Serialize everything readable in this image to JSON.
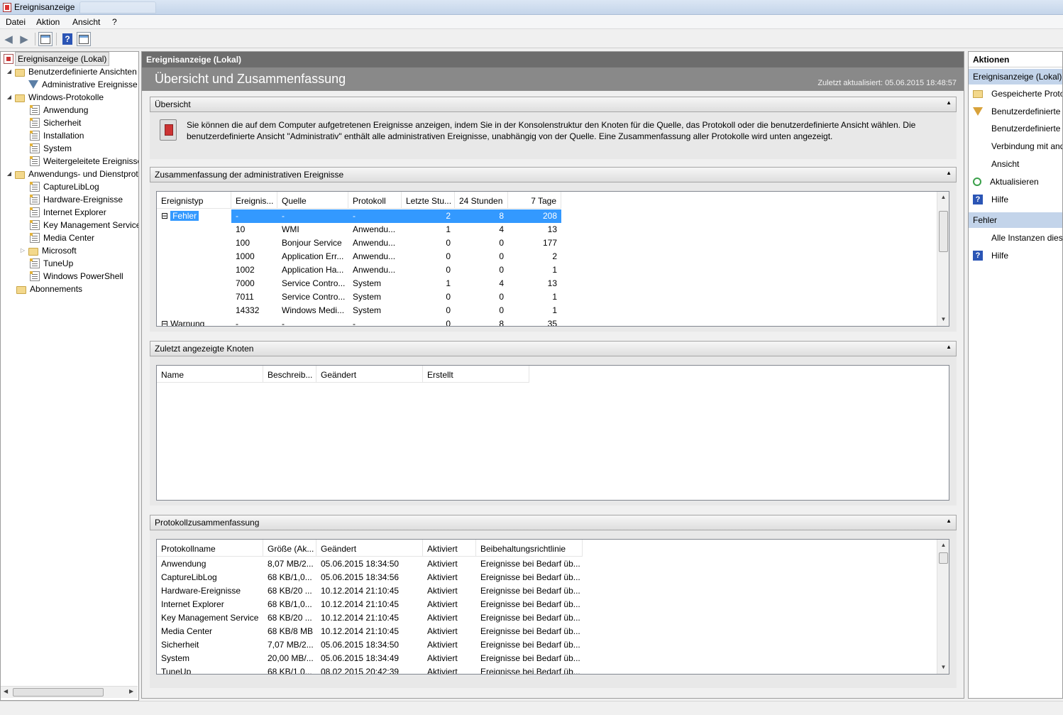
{
  "window": {
    "title": "Ereignisanzeige"
  },
  "menu": [
    "Datei",
    "Aktion",
    "Ansicht",
    "?"
  ],
  "tree": {
    "root": "Ereignisanzeige (Lokal)",
    "custom_views": "Benutzerdefinierte Ansichten",
    "admin_events": "Administrative Ereignisse",
    "windows_logs": "Windows-Protokolle",
    "windows_logs_items": [
      "Anwendung",
      "Sicherheit",
      "Installation",
      "System",
      "Weitergeleitete Ereignisse"
    ],
    "app_services": "Anwendungs- und Dienstprotokolle",
    "app_services_items": [
      "CaptureLibLog",
      "Hardware-Ereignisse",
      "Internet Explorer",
      "Key Management Service",
      "Media Center",
      "Microsoft",
      "TuneUp",
      "Windows PowerShell"
    ],
    "subscriptions": "Abonnements"
  },
  "center": {
    "header": "Ereignisanzeige (Lokal)",
    "title": "Übersicht und Zusammenfassung",
    "updated": "Zuletzt aktualisiert: 05.06.2015 18:48:57",
    "overview": {
      "header": "Übersicht",
      "text": "Sie können die auf dem Computer aufgetretenen Ereignisse anzeigen, indem Sie in der Konsolenstruktur den Knoten für die Quelle, das Protokoll oder die benutzerdefinierte Ansicht wählen. Die benutzerdefinierte Ansicht \"Administrativ\" enthält alle administrativen Ereignisse, unabhängig von der Quelle. Eine Zusammenfassung aller Protokolle wird unten angezeigt."
    },
    "admin_summary": {
      "header": "Zusammenfassung der administrativen Ereignisse",
      "columns": [
        "Ereignistyp",
        "Ereignis...",
        "Quelle",
        "Protokoll",
        "Letzte Stu...",
        "24 Stunden",
        "7 Tage"
      ],
      "rows": [
        [
          "Fehler",
          "-",
          "-",
          "-",
          "2",
          "8",
          "208"
        ],
        [
          "",
          "10",
          "WMI",
          "Anwendu...",
          "1",
          "4",
          "13"
        ],
        [
          "",
          "100",
          "Bonjour Service",
          "Anwendu...",
          "0",
          "0",
          "177"
        ],
        [
          "",
          "1000",
          "Application Err...",
          "Anwendu...",
          "0",
          "0",
          "2"
        ],
        [
          "",
          "1002",
          "Application Ha...",
          "Anwendu...",
          "0",
          "0",
          "1"
        ],
        [
          "",
          "7000",
          "Service Contro...",
          "System",
          "1",
          "4",
          "13"
        ],
        [
          "",
          "7011",
          "Service Contro...",
          "System",
          "0",
          "0",
          "1"
        ],
        [
          "",
          "14332",
          "Windows Medi...",
          "System",
          "0",
          "0",
          "1"
        ],
        [
          "Warnung",
          "-",
          "-",
          "-",
          "0",
          "8",
          "35"
        ]
      ]
    },
    "recent_nodes": {
      "header": "Zuletzt angezeigte Knoten",
      "columns": [
        "Name",
        "Beschreib...",
        "Geändert",
        "Erstellt"
      ]
    },
    "log_summary": {
      "header": "Protokollzusammenfassung",
      "columns": [
        "Protokollname",
        "Größe (Ak...",
        "Geändert",
        "Aktiviert",
        "Beibehaltungsrichtlinie"
      ],
      "rows": [
        [
          "Anwendung",
          "8,07 MB/2...",
          "05.06.2015 18:34:50",
          "Aktiviert",
          "Ereignisse bei Bedarf üb..."
        ],
        [
          "CaptureLibLog",
          "68 KB/1,0...",
          "05.06.2015 18:34:56",
          "Aktiviert",
          "Ereignisse bei Bedarf üb..."
        ],
        [
          "Hardware-Ereignisse",
          "68 KB/20 ...",
          "10.12.2014 21:10:45",
          "Aktiviert",
          "Ereignisse bei Bedarf üb..."
        ],
        [
          "Internet Explorer",
          "68 KB/1,0...",
          "10.12.2014 21:10:45",
          "Aktiviert",
          "Ereignisse bei Bedarf üb..."
        ],
        [
          "Key Management Service",
          "68 KB/20 ...",
          "10.12.2014 21:10:45",
          "Aktiviert",
          "Ereignisse bei Bedarf üb..."
        ],
        [
          "Media Center",
          "68 KB/8 MB",
          "10.12.2014 21:10:45",
          "Aktiviert",
          "Ereignisse bei Bedarf üb..."
        ],
        [
          "Sicherheit",
          "7,07 MB/2...",
          "05.06.2015 18:34:50",
          "Aktiviert",
          "Ereignisse bei Bedarf üb..."
        ],
        [
          "System",
          "20,00 MB/...",
          "05.06.2015 18:34:49",
          "Aktiviert",
          "Ereignisse bei Bedarf üb..."
        ],
        [
          "TuneUp",
          "68 KB/1,0...",
          "08.02.2015 20:42:39",
          "Aktiviert",
          "Ereignisse bei Bedarf üb..."
        ]
      ]
    }
  },
  "actions": {
    "header": "Aktionen",
    "group1": "Ereignisanzeige (Lokal)",
    "items1": [
      "Gespeicherte Protokolle öffnen...",
      "Benutzerdefinierte Ansicht erstellen...",
      "Benutzerdefinierte Ansicht importieren...",
      "Verbindung mit anderem Computer herstellen...",
      "Ansicht",
      "Aktualisieren",
      "Hilfe"
    ],
    "group2": "Fehler",
    "items2": [
      "Alle Instanzen dieses Ereignisses anzeigen",
      "Hilfe"
    ]
  }
}
